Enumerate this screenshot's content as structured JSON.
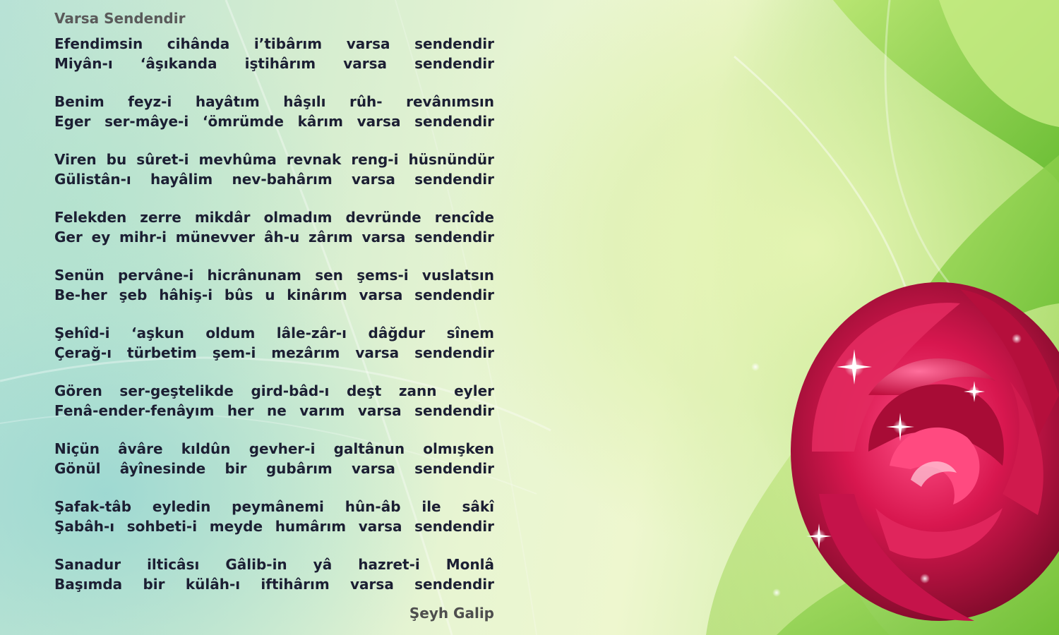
{
  "poem": {
    "title": "Varsa Sendendir",
    "author": "Şeyh Galip",
    "stanzas": [
      [
        "Efendimsin cihânda i’tibârım varsa sendendir",
        "Miyân-ı ‘âşıkanda iştihârım varsa sendendir"
      ],
      [
        "Benim feyz-i hayâtım hâşılı rûh- revânımsın",
        "Eger ser-mâye-i ‘ömrümde kârım varsa sendendir"
      ],
      [
        "Viren bu sûret-i mevhûma revnak reng-i hüsnündür",
        "Gülistân-ı hayâlim nev-bahârım varsa sendendir"
      ],
      [
        "Felekden zerre mikdâr olmadım devründe rencîde",
        "Ger ey mihr-i münevver âh-u zârım varsa sendendir"
      ],
      [
        "Senün pervâne-i hicrânunam sen şems-i vuslatsın",
        "Be-her şeb hâhiş-i bûs u kinârım varsa sendendir"
      ],
      [
        "Şehîd-i ‘aşkun oldum lâle-zâr-ı dâğdur sînem",
        "Çerağ-ı türbetim şem-i mezârım varsa sendendir"
      ],
      [
        "Gören ser-geştelikde gird-bâd-ı deşt zann eyler",
        "Fenâ-ender-fenâyım her ne varım varsa sendendir"
      ],
      [
        "Niçün âvâre kıldûn gevher-i galtânun olmışken",
        "Gönül âyînesinde bir gubârım varsa sendendir"
      ],
      [
        "Şafak-tâb eyledin peymânemi hûn-âb ile sâkî",
        "Şabâh-ı sohbeti-i meyde humârım varsa sendendir"
      ],
      [
        "Sanadur ilticâsı Gâlib-in yâ hazret-i Monlâ",
        "Başımda bir külâh-ı iftihârım varsa sendendir"
      ]
    ]
  },
  "decoration": {
    "image": "red-rose-on-green-leaves-background",
    "colors": {
      "rose": "#d8174f",
      "rose_dark": "#8c0a2e",
      "leaf_green": "#8ccf3c",
      "text": "#1c1f33",
      "title_gray": "#5a5a5a"
    }
  }
}
